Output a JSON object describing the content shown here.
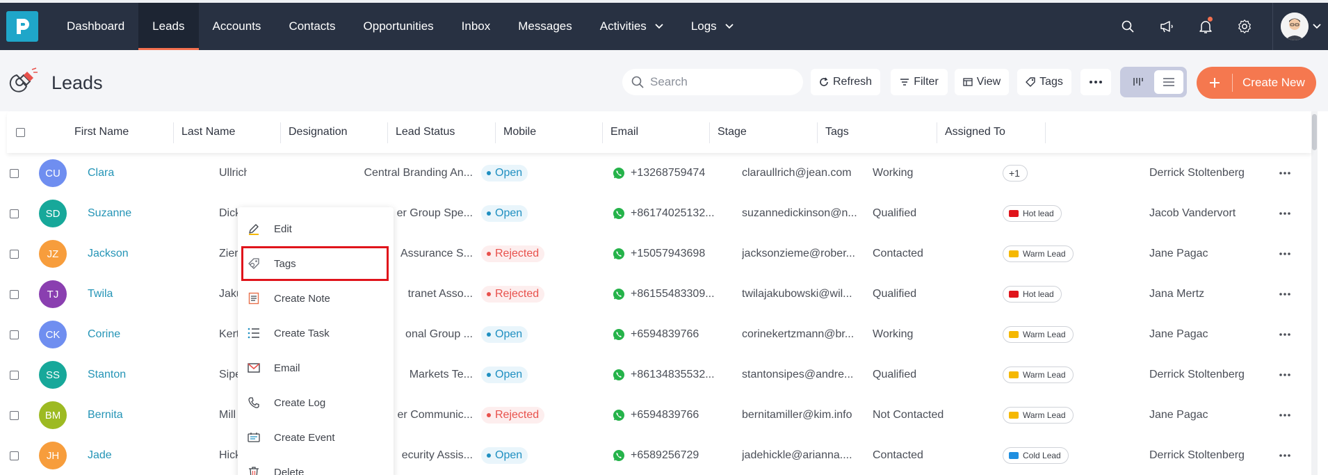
{
  "nav": {
    "items": [
      {
        "label": "Dashboard",
        "active": false
      },
      {
        "label": "Leads",
        "active": true
      },
      {
        "label": "Accounts",
        "active": false
      },
      {
        "label": "Contacts",
        "active": false
      },
      {
        "label": "Opportunities",
        "active": false
      },
      {
        "label": "Inbox",
        "active": false
      },
      {
        "label": "Messages",
        "active": false
      },
      {
        "label": "Activities",
        "active": false,
        "dropdown": true
      },
      {
        "label": "Logs",
        "active": false,
        "dropdown": true
      }
    ],
    "icons": [
      "search-icon",
      "megaphone-icon",
      "bell-icon",
      "gear-icon"
    ]
  },
  "page": {
    "title": "Leads"
  },
  "toolbar": {
    "search_placeholder": "Search",
    "refresh": "Refresh",
    "filter": "Filter",
    "view": "View",
    "tags": "Tags",
    "create_new": "Create New"
  },
  "colors": {
    "accent": "#f5784f",
    "nav_bg": "#283142",
    "link": "#2494b6"
  },
  "table": {
    "columns": [
      "First Name",
      "Last Name",
      "Designation",
      "Lead Status",
      "Mobile",
      "Email",
      "Stage",
      "Tags",
      "Assigned To"
    ],
    "rows": [
      {
        "initials": "CU",
        "color": "#6f8ef0",
        "first": "Clara",
        "last": "Ullrich",
        "designation": "Central Branding An...",
        "status": "Open",
        "mobile": "+13268759474",
        "email": "claraullrich@jean.com",
        "stage": "Working",
        "tag": "+1",
        "tag_color": "",
        "assigned": "Derrick Stoltenberg"
      },
      {
        "initials": "SD",
        "color": "#17a89a",
        "first": "Suzanne",
        "last": "Dicki",
        "designation": "er Group Spe...",
        "status": "Open",
        "mobile": "+86174025132...",
        "email": "suzannedickinson@n...",
        "stage": "Qualified",
        "tag": "Hot lead",
        "tag_color": "#e0141b",
        "assigned": "Jacob Vandervort"
      },
      {
        "initials": "JZ",
        "color": "#f79d3c",
        "first": "Jackson",
        "last": "Zier",
        "designation": "Assurance S...",
        "status": "Rejected",
        "mobile": "+15057943698",
        "email": "jacksonzieme@rober...",
        "stage": "Contacted",
        "tag": "Warm Lead",
        "tag_color": "#f5b800",
        "assigned": "Jane Pagac"
      },
      {
        "initials": "TJ",
        "color": "#8a3fb0",
        "first": "Twila",
        "last": "Jaku",
        "designation": "tranet Asso...",
        "status": "Rejected",
        "mobile": "+86155483309...",
        "email": "twilajakubowski@wil...",
        "stage": "Qualified",
        "tag": "Hot lead",
        "tag_color": "#e0141b",
        "assigned": "Jana Mertz"
      },
      {
        "initials": "CK",
        "color": "#6f8ef0",
        "first": "Corine",
        "last": "Kert",
        "designation": "onal Group ...",
        "status": "Open",
        "mobile": "+6594839766",
        "email": "corinekertzmann@br...",
        "stage": "Working",
        "tag": "Warm Lead",
        "tag_color": "#f5b800",
        "assigned": "Jane Pagac"
      },
      {
        "initials": "SS",
        "color": "#17a89a",
        "first": "Stanton",
        "last": "Sipe",
        "designation": "Markets Te...",
        "status": "Open",
        "mobile": "+86134835532...",
        "email": "stantonsipes@andre...",
        "stage": "Qualified",
        "tag": "Warm Lead",
        "tag_color": "#f5b800",
        "assigned": "Derrick Stoltenberg"
      },
      {
        "initials": "BM",
        "color": "#9dba22",
        "first": "Bernita",
        "last": "Mill",
        "designation": "er Communic...",
        "status": "Rejected",
        "mobile": "+6594839766",
        "email": "bernitamiller@kim.info",
        "stage": "Not Contacted",
        "tag": "Warm Lead",
        "tag_color": "#f5b800",
        "assigned": "Jane Pagac"
      },
      {
        "initials": "JH",
        "color": "#f79d3c",
        "first": "Jade",
        "last": "Hick",
        "designation": "ecurity Assis...",
        "status": "Open",
        "mobile": "+6589256729",
        "email": "jadehickle@arianna....",
        "stage": "Contacted",
        "tag": "Cold Lead",
        "tag_color": "#1f8fe0",
        "assigned": "Derrick Stoltenberg"
      }
    ]
  },
  "context_menu": {
    "items": [
      {
        "label": "Edit",
        "icon": "pencil-icon"
      },
      {
        "label": "Tags",
        "icon": "tag-icon",
        "highlighted": true
      },
      {
        "label": "Create Note",
        "icon": "note-icon"
      },
      {
        "label": "Create Task",
        "icon": "task-list-icon"
      },
      {
        "label": "Email",
        "icon": "mail-icon"
      },
      {
        "label": "Create Log",
        "icon": "phone-icon"
      },
      {
        "label": "Create Event",
        "icon": "event-icon"
      },
      {
        "label": "Delete",
        "icon": "trash-icon"
      }
    ]
  }
}
